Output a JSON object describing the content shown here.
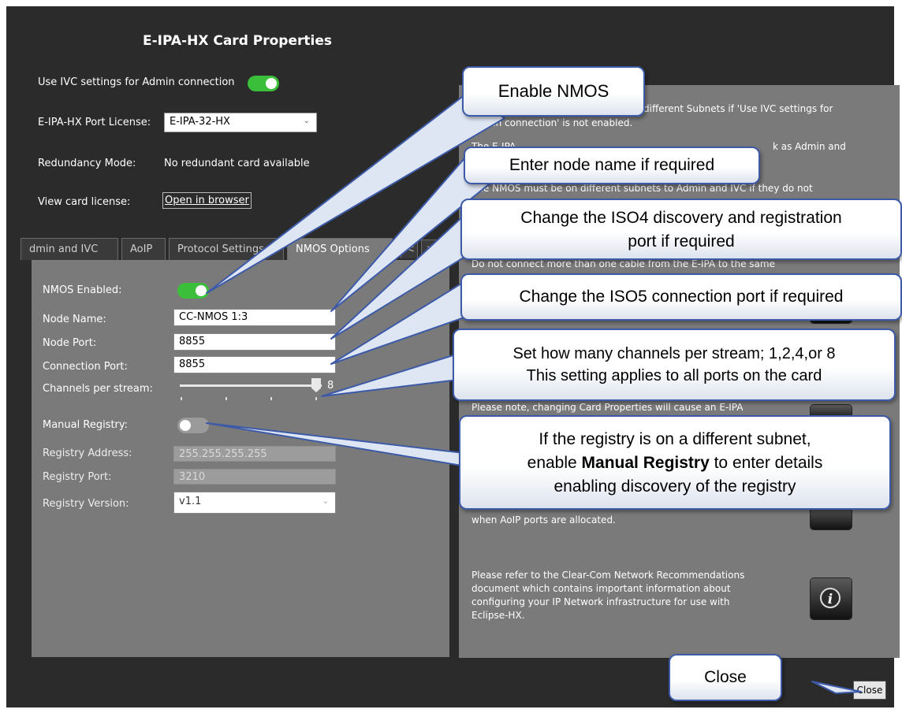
{
  "dialog": {
    "title": "E-IPA-HX Card Properties",
    "use_ivc_label": "Use IVC settings for Admin connection",
    "port_license_label": "E-IPA-HX Port License:",
    "port_license_value": "E-IPA-32-HX",
    "redundancy_label": "Redundancy Mode:",
    "redundancy_value": "No redundant card available",
    "view_license_label": "View card license:",
    "open_browser": "Open in browser"
  },
  "tabs": [
    "dmin and IVC",
    "AoIP",
    "Protocol Settings",
    "NMOS Options",
    "<",
    ">"
  ],
  "nmos": {
    "enabled_label": "NMOS Enabled:",
    "node_name_label": "Node Name:",
    "node_name_value": "CC-NMOS 1:3",
    "node_port_label": "Node Port:",
    "node_port_value": "8855",
    "conn_port_label": "Connection Port:",
    "conn_port_value": "8855",
    "channels_label": "Channels per stream:",
    "channels_value": "8",
    "manual_registry_label": "Manual Registry:",
    "registry_address_label": "Registry Address:",
    "registry_address_value": "255.255.255.255",
    "registry_port_label": "Registry Port:",
    "registry_port_value": "3210",
    "registry_version_label": "Registry Version:",
    "registry_version_value": "v1.1"
  },
  "notes": {
    "n1a": "different Subnets if 'Use IVC settings for",
    "n1b": "Admin connection' is not enabled.",
    "n2a": "The E-IPA ...",
    "n2b": "k as Admin and",
    "n3a": "The NMOS must be on different subnets to Admin and IVC if they do not",
    "n4a": "Do not connect more than one cable from the E-IPA to the same",
    "n5a": "Please note, changing Card Properties will cause an E-IPA",
    "n6a": "when AoIP ports are allocated.",
    "n7": [
      "Please refer to the Clear-Com Network Recommendations",
      "document which contains important information about",
      "configuring your IP Network infrastructure for use with",
      "Eclipse-HX."
    ]
  },
  "close_button": "Close",
  "callouts": {
    "enable_nmos": "Enable NMOS",
    "node_name": "Enter node name if required",
    "iso4_line1": "Change the ISO4 discovery and registration",
    "iso4_line2": "port if required",
    "iso5": "Change the ISO5 connection port if required",
    "channels_line1": "Set how many channels per stream; 1,2,4,or 8",
    "channels_line2": "This setting applies to all ports on the card",
    "registry_line1": "If the registry is on a different subnet,",
    "registry_line2_pre": "enable ",
    "registry_line2_bold": "Manual Registry",
    "registry_line2_post": " to enter details",
    "registry_line3": "enabling discovery of the registry",
    "close": "Close"
  },
  "colors": {
    "dialog_bg": "#2b2b2b",
    "panel_bg": "#7a7a7a",
    "toggle_on": "#3bbf3b",
    "callout_border": "#3c5aa8"
  },
  "icons": [
    "toggle-switch",
    "chevron-down-icon",
    "slider-thumb",
    "info-icon"
  ]
}
